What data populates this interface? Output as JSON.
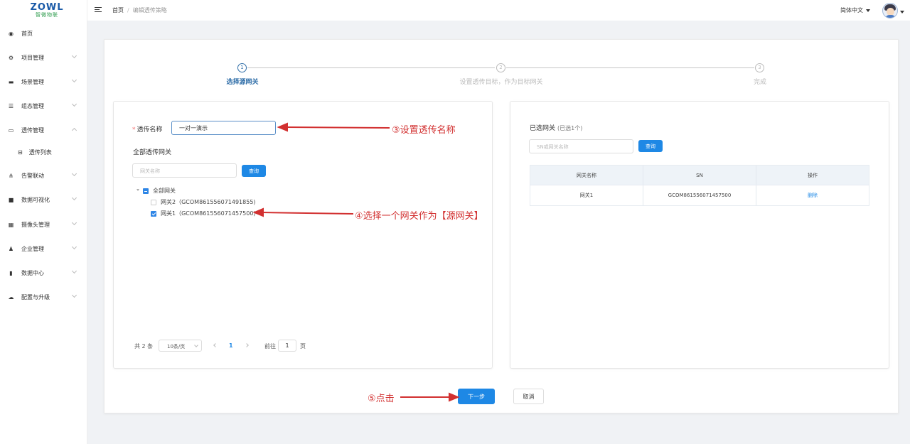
{
  "logo": {
    "main": "ZOWL",
    "sub": "智微物联"
  },
  "sidebar": {
    "items": [
      {
        "label": "首页",
        "icon": "dashboard-icon",
        "glyph": "◉",
        "expandable": false
      },
      {
        "label": "项目管理",
        "icon": "gear-icon",
        "glyph": "⚙",
        "expandable": true
      },
      {
        "label": "场景管理",
        "icon": "folder-icon",
        "glyph": "▬",
        "expandable": true
      },
      {
        "label": "组态管理",
        "icon": "list-icon",
        "glyph": "☰",
        "expandable": true
      },
      {
        "label": "透传管理",
        "icon": "monitor-icon",
        "glyph": "▭",
        "expandable": true,
        "expanded": true
      },
      {
        "label": "告警联动",
        "icon": "nodes-icon",
        "glyph": "⋔",
        "expandable": true
      },
      {
        "label": "数据可视化",
        "icon": "screen-icon",
        "glyph": "■",
        "expandable": true
      },
      {
        "label": "摄像头管理",
        "icon": "grid-icon",
        "glyph": "▦",
        "expandable": true
      },
      {
        "label": "企业管理",
        "icon": "users-icon",
        "glyph": "♟",
        "expandable": true
      },
      {
        "label": "数据中心",
        "icon": "bar-chart-icon",
        "glyph": "▮",
        "expandable": true
      },
      {
        "label": "配置与升级",
        "icon": "cloud-icon",
        "glyph": "☁",
        "expandable": true
      }
    ],
    "subitem": {
      "label": "透传列表",
      "glyph": "⊟"
    }
  },
  "header": {
    "breadcrumb_home": "首页",
    "breadcrumb_sep": "/",
    "breadcrumb_current": "编辑透传策略",
    "language": "简体中文"
  },
  "steps": [
    {
      "num": "1",
      "label": "选择源网关",
      "active": true
    },
    {
      "num": "2",
      "label": "设置透传目标，作为目标网关",
      "active": false
    },
    {
      "num": "3",
      "label": "完成",
      "active": false
    }
  ],
  "left_panel": {
    "name_label": "透传名称",
    "name_value": "一对一演示",
    "all_gateways_title": "全部透传网关",
    "search_placeholder": "网关名称",
    "query_button": "查询",
    "tree_root": "全部网关",
    "tree_items": [
      {
        "label": "网关2（GCOM861556071491855)",
        "checked": false
      },
      {
        "label": "网关1（GCOM861556071457500)",
        "checked": true
      }
    ],
    "pager": {
      "total": "共 2 条",
      "page_size": "10条/页",
      "current_page": "1",
      "goto_prefix": "前往",
      "goto_value": "1",
      "goto_suffix": "页"
    }
  },
  "right_panel": {
    "title": "已选网关",
    "count": "(已选1个)",
    "search_placeholder": "SN或网关名称",
    "query_button": "查询",
    "columns": [
      "网关名称",
      "SN",
      "操作"
    ],
    "rows": [
      {
        "name": "网关1",
        "sn": "GCOM861556071457500",
        "action": "删除"
      }
    ]
  },
  "buttons": {
    "next": "下一步",
    "cancel": "取消"
  },
  "annotations": {
    "a3": "③设置透传名称",
    "a4": "④选择一个网关作为【源网关】",
    "a5": "⑤点击"
  },
  "colors": {
    "primary": "#1e88e5",
    "step_active": "#2f6ea8",
    "annotation": "#d23030"
  }
}
